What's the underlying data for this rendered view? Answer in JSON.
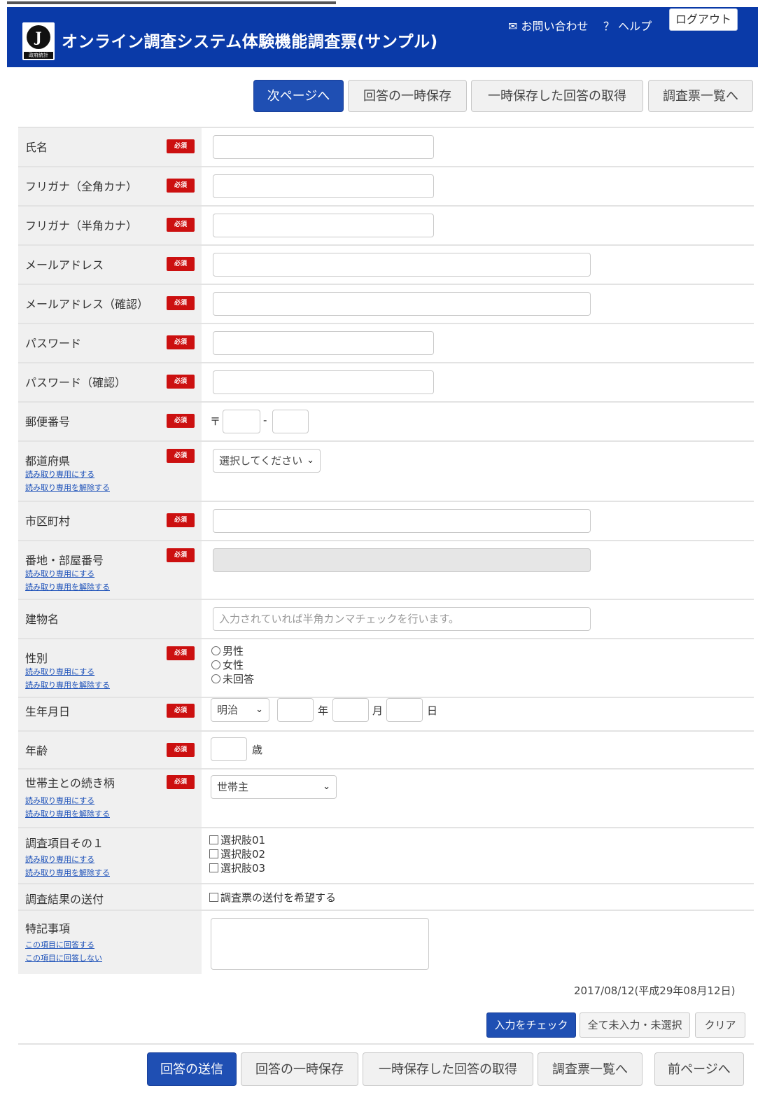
{
  "header": {
    "logo_text": "J",
    "logo_caption": "政府統計",
    "title": "オンライン調査システム体験機能調査票(サンプル)",
    "contact": "✉ お問い合わせ",
    "help": "？ ヘルプ",
    "logout": "ログアウト"
  },
  "top_buttons": {
    "next": "次ページへ",
    "save_temp": "回答の一時保存",
    "load_temp": "一時保存した回答の取得",
    "list": "調査票一覧へ"
  },
  "required_badge": "必須",
  "readonly_on": "読み取り専用にする",
  "readonly_off": "読み取り専用を解除する",
  "fields": {
    "name": "氏名",
    "kana_full": "フリガナ（全角カナ）",
    "kana_half": "フリガナ（半角カナ）",
    "email": "メールアドレス",
    "email_confirm": "メールアドレス（確認）",
    "password": "パスワード",
    "password_confirm": "パスワード（確認）",
    "postal": "郵便番号",
    "postal_mark": "〒",
    "postal_sep": "-",
    "prefecture": "都道府県",
    "prefecture_select": "選択してください",
    "city": "市区町村",
    "address": "番地・部屋番号",
    "building": "建物名",
    "building_placeholder": "入力されていれば半角カンマチェックを行います。",
    "gender": "性別",
    "gender_options": [
      "男性",
      "女性",
      "未回答"
    ],
    "birth": "生年月日",
    "era_select": "明治",
    "year_unit": "年",
    "month_unit": "月",
    "day_unit": "日",
    "age": "年齢",
    "age_unit": "歳",
    "relation": "世帯主との続き柄",
    "relation_select": "世帯主",
    "item1": "調査項目その１",
    "item1_options": [
      "選択肢01",
      "選択肢02",
      "選択肢03"
    ],
    "result_send": "調査結果の送付",
    "result_send_option": "調査票の送付を希望する",
    "notes": "特記事項",
    "notes_link_on": "この項目に回答する",
    "notes_link_off": "この項目に回答しない"
  },
  "date_text": "2017/08/12(平成29年08月12日)",
  "check_buttons": {
    "check": "入力をチェック",
    "all_unentered": "全て未入力・未選択",
    "clear": "クリア"
  },
  "bottom_buttons": {
    "submit": "回答の送信",
    "save_temp": "回答の一時保存",
    "load_temp": "一時保存した回答の取得",
    "list": "調査票一覧へ",
    "prev": "前ページへ"
  }
}
